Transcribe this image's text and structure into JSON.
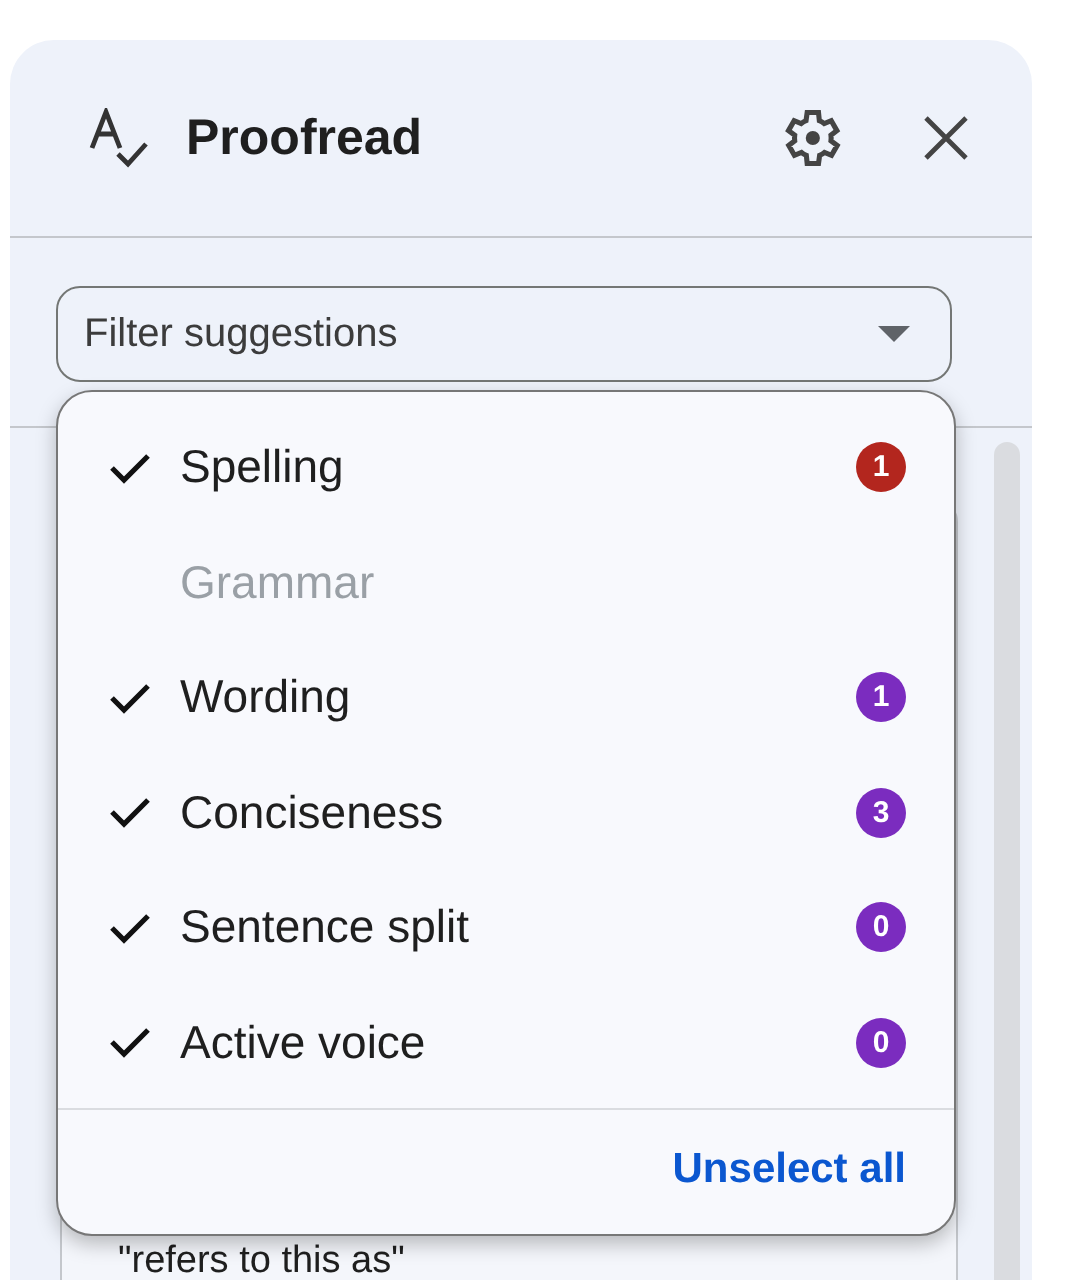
{
  "header": {
    "title": "Proofread"
  },
  "filter": {
    "placeholder": "Filter suggestions"
  },
  "menu": {
    "items": [
      {
        "label": "Spelling",
        "checked": true,
        "disabled": false,
        "count": "1",
        "color": "#b3261e"
      },
      {
        "label": "Grammar",
        "checked": false,
        "disabled": true
      },
      {
        "label": "Wording",
        "checked": true,
        "disabled": false,
        "count": "1",
        "color": "#7b2cbf"
      },
      {
        "label": "Conciseness",
        "checked": true,
        "disabled": false,
        "count": "3",
        "color": "#7b2cbf"
      },
      {
        "label": "Sentence split",
        "checked": true,
        "disabled": false,
        "count": "0",
        "color": "#7b2cbf"
      },
      {
        "label": "Active voice",
        "checked": true,
        "disabled": false,
        "count": "0",
        "color": "#7b2cbf"
      }
    ],
    "action": "Unselect all"
  },
  "suggestion": {
    "text": "\"refers to this as\""
  }
}
